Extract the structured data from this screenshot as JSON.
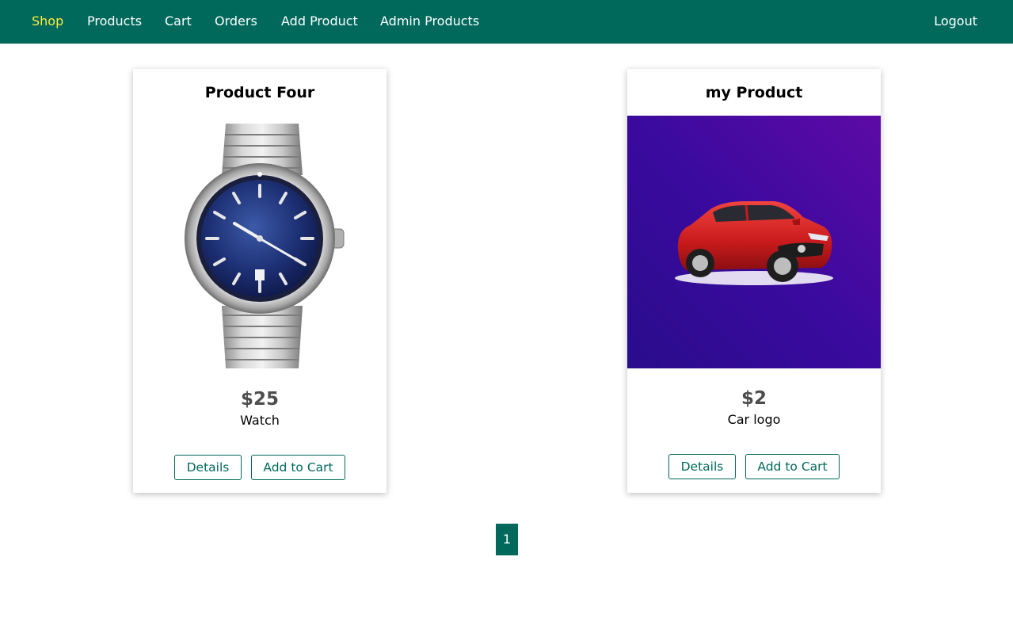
{
  "nav": {
    "left": [
      {
        "label": "Shop",
        "active": true
      },
      {
        "label": "Products",
        "active": false
      },
      {
        "label": "Cart",
        "active": false
      },
      {
        "label": "Orders",
        "active": false
      },
      {
        "label": "Add Product",
        "active": false
      },
      {
        "label": "Admin Products",
        "active": false
      }
    ],
    "right": {
      "label": "Logout"
    }
  },
  "products": [
    {
      "title": "Product Four",
      "image_icon": "watch-image",
      "price": "$25",
      "description": "Watch",
      "details_label": "Details",
      "add_to_cart_label": "Add to Cart"
    },
    {
      "title": "my Product",
      "image_icon": "car-image",
      "price": "$2",
      "description": "Car logo",
      "details_label": "Details",
      "add_to_cart_label": "Add to Cart"
    }
  ],
  "pagination": {
    "current": "1"
  },
  "colors": {
    "header": "#00695c",
    "active_nav": "#ffeb3b",
    "primary": "#00695c",
    "price": "#4d4d4d"
  }
}
